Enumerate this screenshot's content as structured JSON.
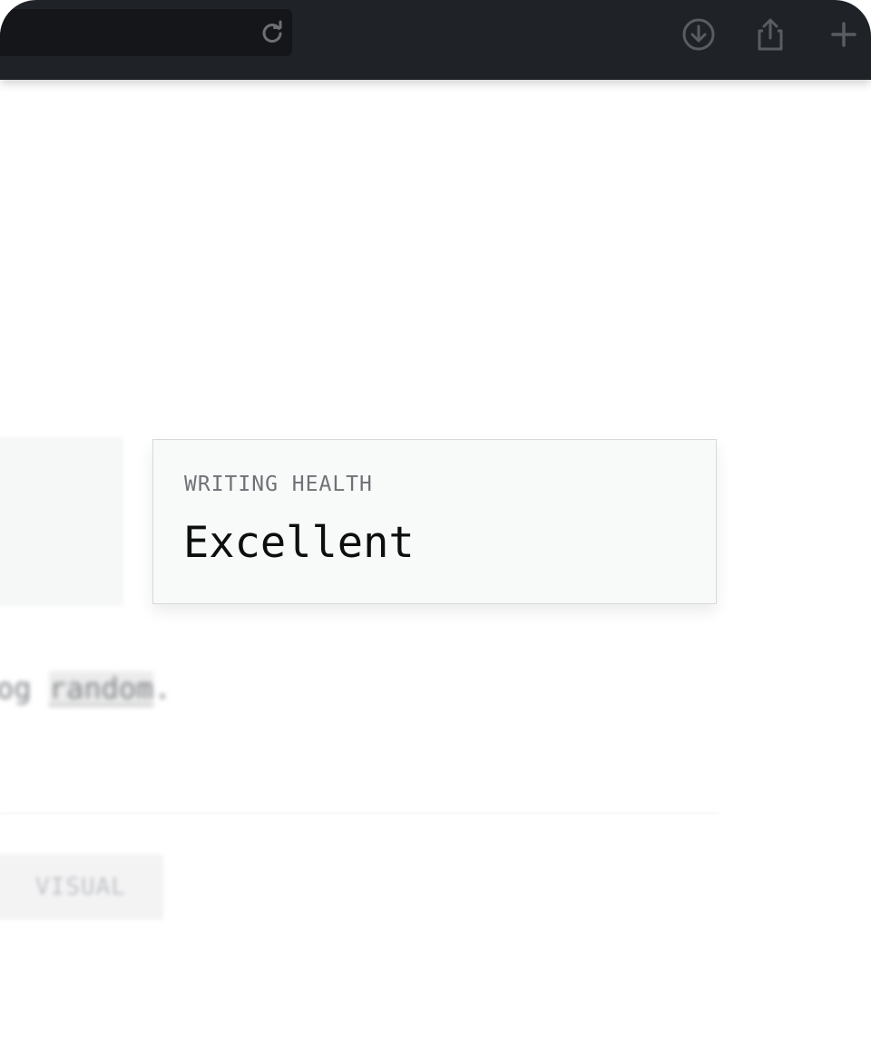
{
  "toolbar": {
    "icons": {
      "reload": "reload-icon",
      "download": "download-icon",
      "share": "share-icon",
      "new_tab": "plus-icon"
    }
  },
  "background": {
    "sentence_prefix": "og ",
    "sentence_link": "random",
    "sentence_suffix": ".",
    "button_label": "VISUAL"
  },
  "health_card": {
    "label": "WRITING HEALTH",
    "value": "Excellent"
  },
  "colors": {
    "toolbar_bg": "#1f2226",
    "card_bg": "#f8f9f9",
    "label_text": "#6e7276",
    "value_text": "#0d0e0f"
  }
}
